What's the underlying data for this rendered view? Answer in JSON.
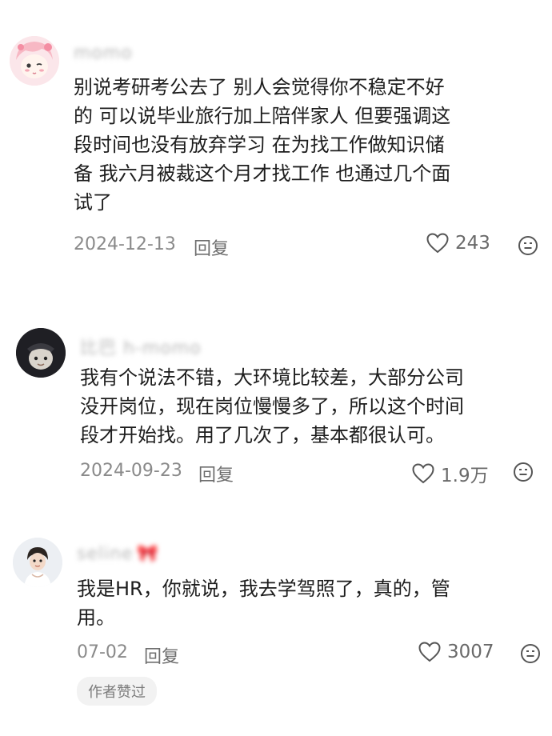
{
  "comments": [
    {
      "username": "momo",
      "lines": [
        "别说考研考公去了 别人会觉得你不稳定不好",
        "的 可以说毕业旅行加上陪伴家人 但要强调这",
        "段时间也没有放弃学习 在为找工作做知识储",
        "备 我六月被裁这个月才找工作 也通过几个面",
        "试了"
      ],
      "date": "2024-12-13",
      "reply_label": "回复",
      "likes": "243"
    },
    {
      "username": "比巴 h-momo",
      "lines": [
        "我有个说法不错，大环境比较差，大部分公司",
        "没开岗位，现在岗位慢慢多了，所以这个时间",
        "段才开始找。用了几次了，基本都很认可。"
      ],
      "date": "2024-09-23",
      "reply_label": "回复",
      "likes": "1.9万"
    },
    {
      "username": "seline",
      "lines": [
        "我是HR，你就说，我去学驾照了，真的，管",
        "用。"
      ],
      "date": "07-02",
      "reply_label": "回复",
      "likes": "3007",
      "badge": "作者赞过"
    }
  ],
  "icons": {
    "like": "heart-outline-icon",
    "emoji": "smiley-face-icon"
  },
  "colors": {
    "text": "#1d1d1d",
    "meta": "#8a8a8a",
    "badge_bg": "#f2f2f2"
  }
}
